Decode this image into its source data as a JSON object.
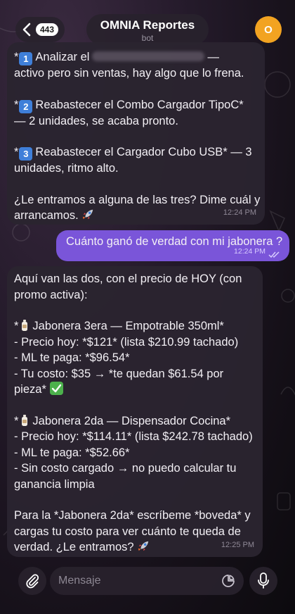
{
  "header": {
    "back_count": "443",
    "title": "OMNIA Reportes",
    "subtitle": "bot",
    "avatar_letter": "O"
  },
  "messages": {
    "m1": {
      "lines": [
        "— ",
        "activo pero sin ventas, hay algo que lo frena.",
        "Reabastecer el Combo Cargador TipoC*",
        "— 2 unidades, se acaba pronto.",
        "Reabastecer el Cargador Cubo USB* — 3",
        "unidades, ritmo alto.",
        "¿Le entramos a alguna de las tres? Dime cuál y",
        "arrancamos."
      ],
      "item1_prefix": "Analizar el",
      "time": "12:24 PM"
    },
    "m2": {
      "text": "Cuánto ganó de verdad con mi jabonera ?",
      "time": "12:24 PM"
    },
    "m3": {
      "lines": [
        "Aquí van las dos, con el precio de HOY (con",
        "promo activa):",
        "Jabonera 3era — Empotrable 350ml*",
        "- Precio hoy: *$121* (lista $210.99 tachado)",
        "- ML te paga: *$96.54*",
        "- Tu costo: $35 → *te quedan $61.54 por",
        "pieza*",
        "Jabonera 2da — Dispensador Cocina*",
        "- Precio hoy: *$114.11* (lista $242.78 tachado)",
        "- ML te paga: *$52.66*",
        "- Sin costo cargado → no puedo calcular tu",
        "ganancia limpia",
        "Para la *Jabonera 2da* escríbeme *boveda* y",
        "cargas tu costo para ver cuánto te queda de",
        "verdad. ¿Le entramos?"
      ],
      "time": "12:25 PM"
    }
  },
  "composer": {
    "placeholder": "Mensaje"
  },
  "colors": {
    "accent": "#7a55d9",
    "key_blue": "#3f7fd9",
    "avatar": "#f2a321",
    "bubble": "#2a2430"
  },
  "icons": [
    "chevron-left-icon",
    "paperclip-icon",
    "sticker-icon",
    "microphone-icon",
    "double-check-icon",
    "rocket-emoji",
    "bottle-emoji",
    "check-mark-emoji",
    "keycap-icon"
  ]
}
